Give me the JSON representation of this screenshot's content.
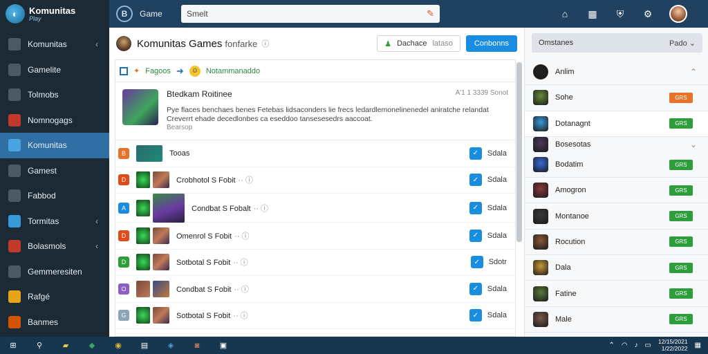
{
  "app": {
    "name": "Komunitas",
    "tagline": "Play"
  },
  "sidebar": {
    "items": [
      {
        "label": "Komunitas",
        "icon": "flag-icon",
        "chevron": "‹",
        "color": "#4a5a66"
      },
      {
        "label": "Gamelite",
        "icon": "grid-icon",
        "chevron": "",
        "color": "#4a5a66"
      },
      {
        "label": "Tolmobs",
        "icon": "box-icon",
        "chevron": "",
        "color": "#4a5a66"
      },
      {
        "label": "Nomnogags",
        "icon": "game-icon",
        "chevron": "",
        "color": "#c0392b"
      },
      {
        "label": "Komunitas",
        "icon": "community-icon",
        "chevron": "",
        "color": "#4aa3df"
      },
      {
        "label": "Gamest",
        "icon": "chart-icon",
        "chevron": "",
        "color": "#4a5a66"
      },
      {
        "label": "Fabbod",
        "icon": "list-icon",
        "chevron": "",
        "color": "#4a5a66"
      },
      {
        "label": "Tormitas",
        "icon": "puzzle-icon",
        "chevron": "‹",
        "color": "#3a9ad9"
      },
      {
        "label": "Bolasmols",
        "icon": "controller-icon",
        "chevron": "‹",
        "color": "#c0392b"
      },
      {
        "label": "Gemmeresiten",
        "icon": "people-icon",
        "chevron": "",
        "color": "#4a5a66"
      },
      {
        "label": "Rafgé",
        "icon": "smile-icon",
        "chevron": "",
        "color": "#e6a417"
      },
      {
        "label": "Banmes",
        "icon": "fire-icon",
        "chevron": "",
        "color": "#d35400"
      }
    ]
  },
  "topbar": {
    "title": "Game",
    "app_initial": "B",
    "search_value": "Smelt",
    "icons": [
      "home-icon",
      "grid-icon",
      "shield-icon",
      "settings-icon"
    ]
  },
  "main": {
    "title": "Komunitas Games",
    "subtitle": "fonfarke",
    "btn_secondary": "Dachace",
    "btn_secondary_extra": "lataso",
    "btn_primary": "Conbonns",
    "crumb_from": "Fagoos",
    "crumb_to": "Notammanaddo",
    "feature": {
      "title": "Btedkam Roitinee",
      "meta": "A'1  1 3339 Sonot",
      "desc": "Pye flaces benchaes benes Fetebas lidsaconders lie frecs ledardlemonelinenedel aniratche relandat Creverrt ehade decedlonbes ca eseddoo tansesesedrs aaccoat.",
      "more": "Bearsop"
    },
    "rows": [
      {
        "name": "Tooas",
        "badge": "B",
        "badge_color": "#e8722a",
        "thumb": "wide",
        "action": "Sdala"
      },
      {
        "name": "Crobhotol S Fobit",
        "badge": "D",
        "badge_color": "#e04b1a",
        "thumb": "pair",
        "action": "Sdala"
      },
      {
        "name": "Condbat S Fobalt",
        "badge": "A",
        "badge_color": "#1b8de0",
        "thumb": "tall",
        "action": "Sdala"
      },
      {
        "name": "Omenrol S Fobit",
        "badge": "D",
        "badge_color": "#e04b1a",
        "thumb": "pair",
        "action": "Sdala"
      },
      {
        "name": "Sotbotal S Fobit",
        "badge": "D",
        "badge_color": "#2e9e3c",
        "thumb": "pair",
        "action": "Sdotr"
      },
      {
        "name": "Condbat S Fobit",
        "badge": "O",
        "badge_color": "#8c5fc7",
        "thumb": "pair2",
        "action": "Sdala"
      },
      {
        "name": "Sotbotal S Fobit",
        "badge": "G",
        "badge_color": "#8fa3b8",
        "thumb": "pair",
        "action": "Sdala"
      }
    ]
  },
  "right": {
    "header_label": "Omstanes",
    "header_select": "Pado",
    "items": [
      {
        "name": "Anlim",
        "tag": "",
        "tag_color": "",
        "avatar": "#222",
        "kind": "chev-up"
      },
      {
        "name": "Sohe",
        "tag": "GRS",
        "tag_color": "#e8722a",
        "avatar": "#6a8a3a",
        "kind": "tag"
      },
      {
        "name": "Dotanagnt",
        "tag": "GRS",
        "tag_color": "#2e9e3c",
        "avatar": "#3a9ad9",
        "kind": "tag",
        "highlight": true
      },
      {
        "name": "Bosesotas",
        "tag": "",
        "tag_color": "",
        "avatar": "#4a3a5a",
        "kind": "chev-down",
        "group": true
      },
      {
        "name": "Bodatim",
        "tag": "GRS",
        "tag_color": "#2e9e3c",
        "avatar": "#3a6ad9",
        "kind": "tag"
      },
      {
        "name": "Amogron",
        "tag": "GRS",
        "tag_color": "#2e9e3c",
        "avatar": "#8a3a3a",
        "kind": "tag"
      },
      {
        "name": "Montanoe",
        "tag": "GRS",
        "tag_color": "#2e9e3c",
        "avatar": "#3a3a3a",
        "kind": "tag"
      },
      {
        "name": "Rocution",
        "tag": "GRS",
        "tag_color": "#2e9e3c",
        "avatar": "#8a5a3a",
        "kind": "tag"
      },
      {
        "name": "Dala",
        "tag": "GRS",
        "tag_color": "#2e9e3c",
        "avatar": "#c79a3a",
        "kind": "tag"
      },
      {
        "name": "Fatine",
        "tag": "GRS",
        "tag_color": "#2e9e3c",
        "avatar": "#5a7a3a",
        "kind": "tag"
      },
      {
        "name": "Male",
        "tag": "GRS",
        "tag_color": "#2e9e3c",
        "avatar": "#7a5a4a",
        "kind": "tag"
      }
    ]
  },
  "taskbar": {
    "apps": [
      "windows-icon",
      "search-icon",
      "folder-icon",
      "app-icon",
      "chrome-icon",
      "calculator-icon",
      "store-icon",
      "game-icon",
      "photos-icon"
    ],
    "time": "12/15/2021",
    "date": "1/22/2022"
  },
  "colors": {
    "accent": "#1b8de0",
    "sidebar": "#1c2a36",
    "topbar": "#20415f",
    "active": "#2f6fa3",
    "green": "#2e9e3c"
  }
}
